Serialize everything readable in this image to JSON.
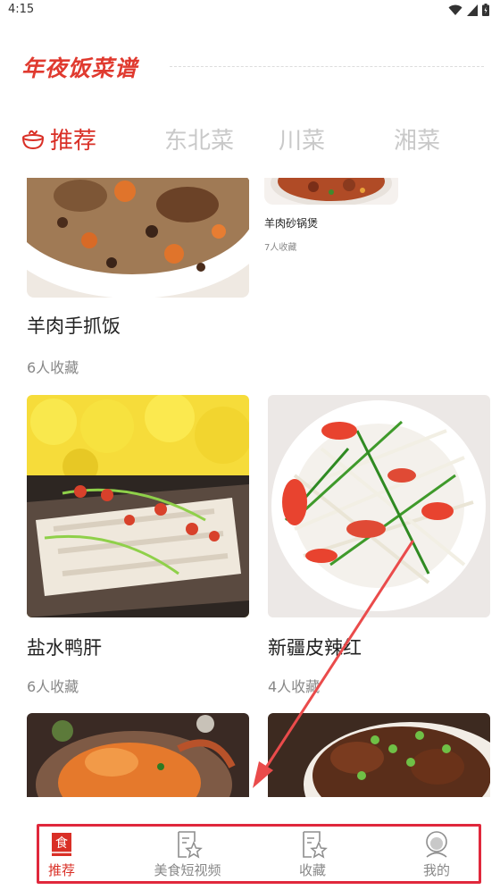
{
  "status_bar": {
    "time": "4:15"
  },
  "header": {
    "title": "年夜饭菜谱"
  },
  "tabs": [
    {
      "label": "推荐",
      "active": true
    },
    {
      "label": "东北菜"
    },
    {
      "label": "川菜"
    },
    {
      "label": "湘菜"
    }
  ],
  "feed": {
    "left_top": {
      "title": "羊肉手抓饭",
      "favorites": "6人收藏"
    },
    "right_top": {
      "title": "羊肉砂锅煲",
      "favorites": "7人收藏"
    },
    "row2_left": {
      "title": "盐水鸭肝",
      "favorites": "6人收藏"
    },
    "row2_right": {
      "title": "新疆皮辣红",
      "favorites": "4人收藏"
    }
  },
  "bottom_nav": [
    {
      "label": "推荐",
      "active": true,
      "icon": "recommend-icon"
    },
    {
      "label": "美食短视频",
      "icon": "video-icon"
    },
    {
      "label": "收藏",
      "icon": "favorites-icon"
    },
    {
      "label": "我的",
      "icon": "profile-icon"
    }
  ],
  "colors": {
    "accent": "#d92f26",
    "highlight_box": "#e0283c",
    "inactive_tab": "#c9c9c9"
  }
}
